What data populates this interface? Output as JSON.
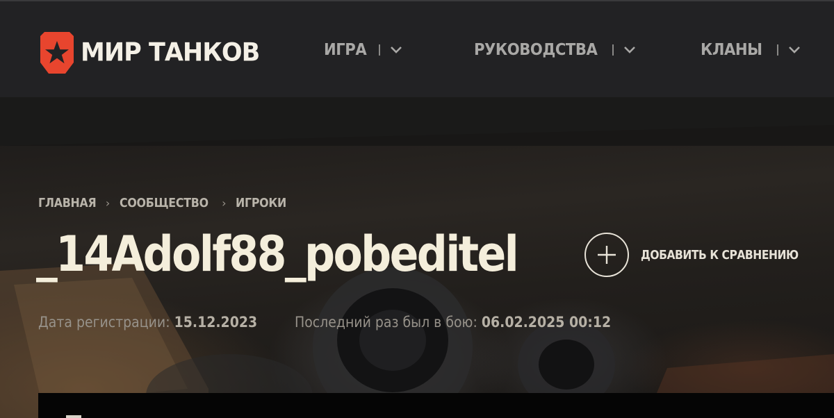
{
  "header": {
    "logo_text": "МИР ТАНКОВ",
    "brand_color": "#e8452e",
    "nav": [
      {
        "label": "ИГРА"
      },
      {
        "label": "РУКОВОДСТВА"
      },
      {
        "label": "КЛАНЫ"
      }
    ]
  },
  "breadcrumb": [
    {
      "label": "ГЛАВНАЯ"
    },
    {
      "label": "СООБЩЕСТВО"
    },
    {
      "label": "ИГРОКИ"
    }
  ],
  "breadcrumb_separator": "›",
  "player": {
    "name": "_14Adolf88_pobeditel",
    "registration_label": "Дата регистрации:",
    "registration_date": "15.12.2023",
    "last_battle_label": "Последний раз был в бою:",
    "last_battle_date": "06.02.2025 00:12"
  },
  "compare": {
    "label": "ДОБАВИТЬ К СРАВНЕНИЮ",
    "icon": "plus-circle-icon"
  }
}
